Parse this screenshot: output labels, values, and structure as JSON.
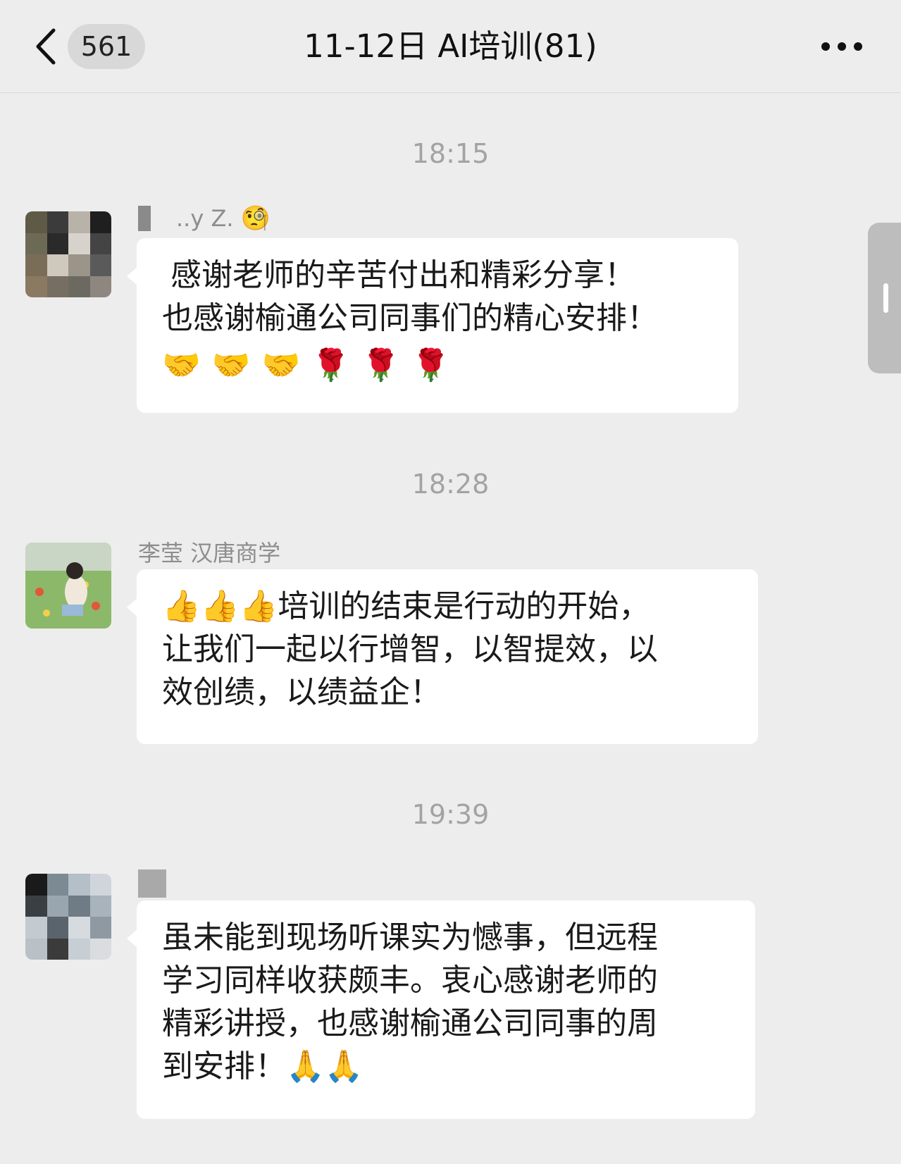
{
  "header": {
    "back_label": "‹",
    "unread_count": "561",
    "title": "11-12日 AI培训(81)",
    "more_label": "•••"
  },
  "messages": [
    {
      "time": "18:15",
      "sender": "..y Z.",
      "sender_emoji": "🧐",
      "lines": [
        "感谢老师的辛苦付出和精彩分享！",
        "也感谢榆通公司同事们的精心安排！"
      ],
      "emojis": [
        "🤝",
        "🤝",
        "🤝",
        "🌹",
        "🌹",
        "🌹"
      ]
    },
    {
      "time": "18:28",
      "sender": "李莹 汉唐商学",
      "lead_emojis": "👍👍👍",
      "lines": [
        "培训的结束是行动的开始，",
        "让我们一起以行增智，以智提效，以",
        "效创绩，以绩益企！"
      ]
    },
    {
      "time": "19:39",
      "sender": "",
      "lines": [
        "虽未能到现场听课实为憾事，但远程",
        "学习同样收获颇丰。衷心感谢老师的",
        "精彩讲授，也感谢榆通公司同事的周"
      ],
      "last_line": "到安排！",
      "trailing_emojis": "🙏🙏"
    }
  ],
  "colors": {
    "background": "#ededed",
    "bubble": "#ffffff",
    "time_text": "#a3a3a3",
    "sender_text": "#8d8d8d"
  }
}
